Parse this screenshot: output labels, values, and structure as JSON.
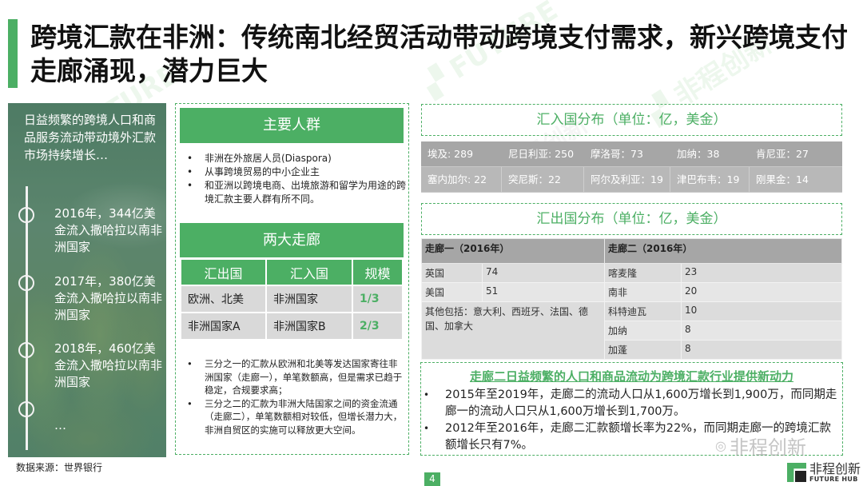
{
  "header": {
    "title_bold": "跨境汇款在非洲：",
    "title_rest": "传统南北经贸活动带动跨境支付需求，新兴跨境支付走廊涌现，潜力巨大"
  },
  "left_panel": {
    "intro": "日益频繁的跨境人口和商品服务流动带动境外汇款市场持续增长…",
    "timeline": [
      {
        "text": "2016年，344亿美金流入撒哈拉以南非洲国家"
      },
      {
        "text": "2017年，380亿美金流入撒哈拉以南非洲国家"
      },
      {
        "text": "2018年，460亿美金流入撒哈拉以南非洲国家"
      },
      {
        "text": "…"
      }
    ],
    "source": "数据来源：世界银行"
  },
  "main_groups": {
    "heading": "主要人群",
    "items": [
      "非洲在外旅居人员(Diaspora)",
      "从事跨境贸易的中小企业主",
      "和亚洲以跨境电商、出境旅游和留学为用途的跨境汇款主要人群有所不同。"
    ]
  },
  "corridors": {
    "heading": "两大走廊",
    "columns": [
      "汇出国",
      "汇入国",
      "规模"
    ],
    "rows": [
      {
        "from": "欧洲、北美",
        "to": "非洲国家",
        "scale": "1/3"
      },
      {
        "from": "非洲国家A",
        "to": "非洲国家B",
        "scale": "2/3"
      }
    ],
    "notes": [
      "三分之一的汇款从欧洲和北美等发达国家寄往非洲国家（走廊一），单笔数额高，但是需求已趋于稳定，合规要求高；",
      "三分之二的汇款为非洲大陆国家之间的资金流通（走廊二），单笔数额相对较低，但增长潜力大，非洲自贸区的实施可以释放更大空间。"
    ]
  },
  "inbound": {
    "heading": "汇入国分布（单位：亿，美金）",
    "row1": [
      "埃及: 289",
      "尼日利亚: 250",
      "摩洛哥：73",
      "加纳：38",
      "肯尼亚：27"
    ],
    "row2": [
      "塞内加尔: 22",
      "突尼斯：22",
      "阿尔及利亚：19",
      "津巴布韦：19",
      "刚果金：14"
    ]
  },
  "outbound": {
    "heading": "汇出国分布（单位：亿，美金）",
    "corridor1_header": "走廊一（2016年）",
    "corridor2_header": "走廊二（2016年）",
    "corridor1": [
      {
        "country": "英国",
        "value": "74"
      },
      {
        "country": "美国",
        "value": "51"
      }
    ],
    "corridor1_other": "其他包括：意大利、西班牙、法国、德国、加拿大",
    "corridor2": [
      {
        "country": "喀麦隆",
        "value": "23"
      },
      {
        "country": "南非",
        "value": "20"
      },
      {
        "country": "科特迪瓦",
        "value": "10"
      },
      {
        "country": "加纳",
        "value": "8"
      },
      {
        "country": "加蓬",
        "value": "8"
      }
    ]
  },
  "insight": {
    "title": "走廊二日益频繁的人口和商品流动为跨境汇款行业提供新动力",
    "items": [
      "2015年至2019年，走廊二的流动人口从1,600万增长到1,900万，而同期走廊一的流动人口只从1,600万增长到1,700万。",
      "2012年至2016年，走廊二汇款额增长率为22%，而同期走廊一的跨境汇款额增长只有7%。"
    ]
  },
  "footer": {
    "page_number": "4",
    "wechat_watermark": "非程创新",
    "logo_cn": "非程创新",
    "logo_en": "FUTURE HUB"
  },
  "colors": {
    "accent_green": "#4CAF64",
    "table_gray": "#a6a6a6",
    "cell_gray": "#d9d9d9"
  }
}
